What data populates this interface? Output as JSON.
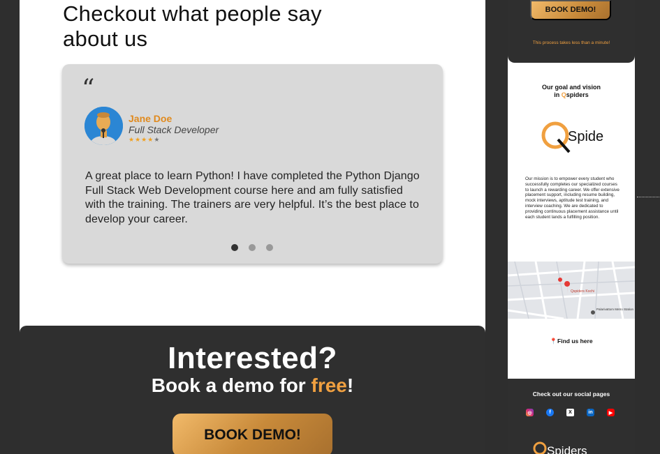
{
  "testimonials": {
    "heading": "Checkout what people say about us",
    "quote_mark": "“",
    "person": {
      "name": "Jane Doe",
      "role": "Full Stack Developer",
      "rating": 4,
      "max_rating": 5
    },
    "text": "A great place to learn Python! I have completed the Python Django Full Stack Web Development course here and am fully satisfied with the training. The trainers are very helpful. It’s the best place to develop your career.",
    "slide_count": 3,
    "active_slide": 1
  },
  "cta": {
    "title": "Interested?",
    "subtitle_prefix": "Book a demo for ",
    "subtitle_accent": "free",
    "subtitle_suffix": "!",
    "button_label": "BOOK DEMO!"
  },
  "sidebar": {
    "demo_button_label": "BOOK DEMO!",
    "process_note": "This process takes less than a minute!",
    "vision_title_line1": "Our goal and vision",
    "vision_title_prefix": "in ",
    "vision_brand_q": "Q",
    "vision_brand_rest": "spiders",
    "logo_text": "Spiders",
    "mission": "Our mission is to empower every student who successfully completes our specialized courses to launch a rewarding career. We offer extensive placement support, including resume building, mock interviews, aptitude test training, and interview coaching. We are dedicated to providing continuous placement assistance until each student lands a fulfilling position.",
    "map_labels": {
      "place": "Qspiders Kochi",
      "station": "Palarivattom Metro Station"
    },
    "find_us": "Find us here",
    "social_title": "Check out our social pages",
    "social_icons": [
      "instagram-icon",
      "facebook-icon",
      "x-icon",
      "linkedin-icon",
      "youtube-icon"
    ]
  },
  "colors": {
    "accent": "#f0a040",
    "dark_panel": "#2f2f2f",
    "card": "#d9d9d9"
  }
}
